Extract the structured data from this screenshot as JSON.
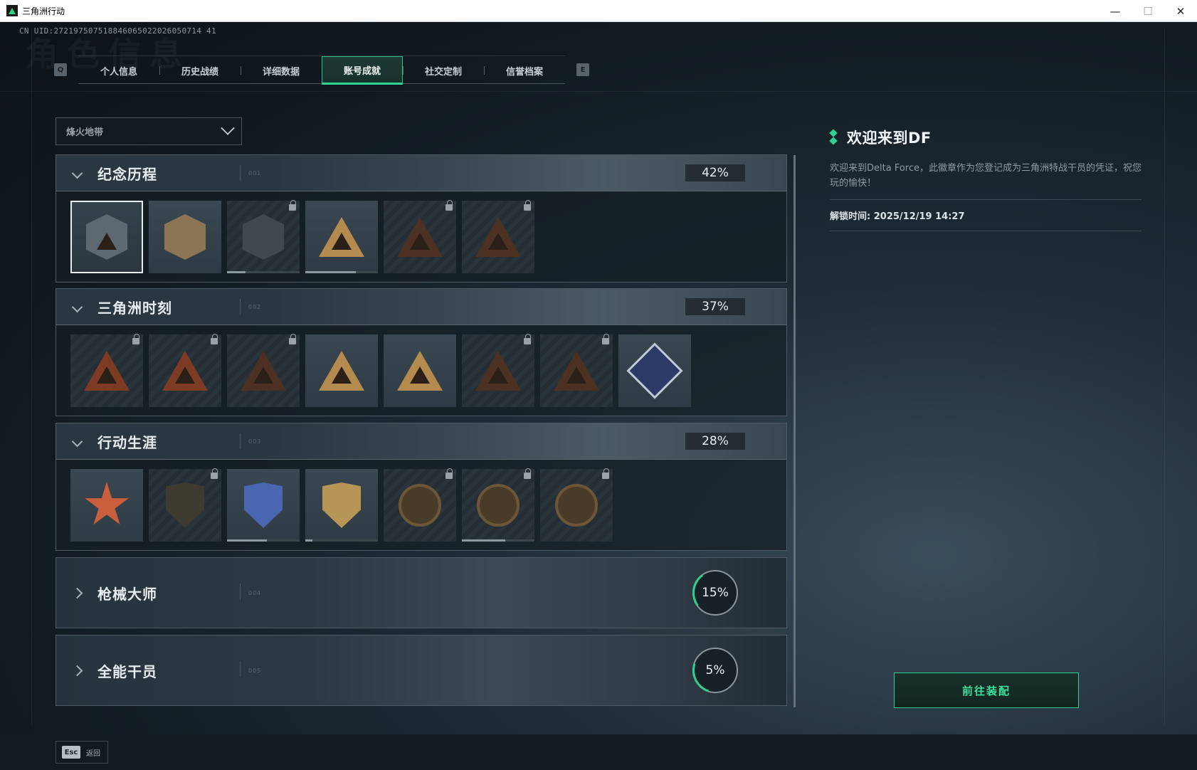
{
  "window": {
    "title": "三角洲行动",
    "minimize": "—",
    "maximize": "☐",
    "close": "✕"
  },
  "uid": "CN UID:272197507518846065022026050714 41",
  "ghost_title": "角色信息",
  "tabs": {
    "left_key": "Q",
    "right_key": "E",
    "items": [
      "个人信息",
      "历史战绩",
      "详细数据",
      "账号成就",
      "社交定制",
      "信誉档案"
    ],
    "active": "账号成就"
  },
  "mode_select": {
    "value": "烽火地带"
  },
  "categories": [
    {
      "name": "纪念历程",
      "number": "001",
      "percent": "42%",
      "expanded": true,
      "badges": [
        {
          "shape": "tri-hex",
          "state": "selected",
          "locked": false
        },
        {
          "shape": "heli-shield",
          "state": "owned",
          "locked": false
        },
        {
          "shape": "hex",
          "state": "dim",
          "locked": true,
          "progress": 0.25
        },
        {
          "shape": "tri-gold",
          "state": "owned",
          "locked": false,
          "progress": 0.7
        },
        {
          "shape": "tri",
          "state": "dim",
          "locked": true
        },
        {
          "shape": "tri",
          "state": "dim",
          "locked": true
        }
      ]
    },
    {
      "name": "三角洲时刻",
      "number": "002",
      "percent": "37%",
      "expanded": true,
      "badges": [
        {
          "shape": "tri-red",
          "state": "dim",
          "locked": true
        },
        {
          "shape": "tri-red",
          "state": "dim",
          "locked": true
        },
        {
          "shape": "tri",
          "state": "dim",
          "locked": true
        },
        {
          "shape": "tri-gold",
          "state": "owned",
          "locked": false
        },
        {
          "shape": "tri-gold",
          "state": "owned",
          "locked": false
        },
        {
          "shape": "tri",
          "state": "dim",
          "locked": true
        },
        {
          "shape": "tri",
          "state": "dim",
          "locked": true
        },
        {
          "shape": "diamond",
          "state": "owned",
          "locked": false
        }
      ]
    },
    {
      "name": "行动生涯",
      "number": "003",
      "percent": "28%",
      "expanded": true,
      "badges": [
        {
          "shape": "star",
          "state": "owned",
          "locked": false
        },
        {
          "shape": "shield",
          "state": "dim",
          "locked": true
        },
        {
          "shape": "shield-blue",
          "state": "owned",
          "locked": false,
          "progress": 0.55
        },
        {
          "shape": "shield-gold",
          "state": "owned",
          "locked": false,
          "progress": 0.1
        },
        {
          "shape": "coin",
          "state": "dim",
          "locked": true
        },
        {
          "shape": "coin",
          "state": "dim",
          "locked": true,
          "progress": 0.6
        },
        {
          "shape": "coin",
          "state": "dim",
          "locked": true
        }
      ]
    },
    {
      "name": "枪械大师",
      "number": "004",
      "percent": "15%",
      "expanded": false,
      "ring_fraction": 0.15
    },
    {
      "name": "全能干员",
      "number": "005",
      "percent": "5%",
      "expanded": false,
      "ring_fraction": 0.05
    }
  ],
  "detail": {
    "title": "欢迎来到DF",
    "description": "欢迎来到Delta Force，此徽章作为您登记成为三角洲特战干员的凭证，祝您玩的愉快！",
    "unlock_time": "解锁时间: 2025/12/19 14:27"
  },
  "equip_button": "前往装配",
  "esc": {
    "key": "Esc",
    "label": "返回"
  },
  "colors": {
    "accent": "#2fd493",
    "panel_border": "#4f5a62",
    "lock": "#9aa3a9"
  }
}
